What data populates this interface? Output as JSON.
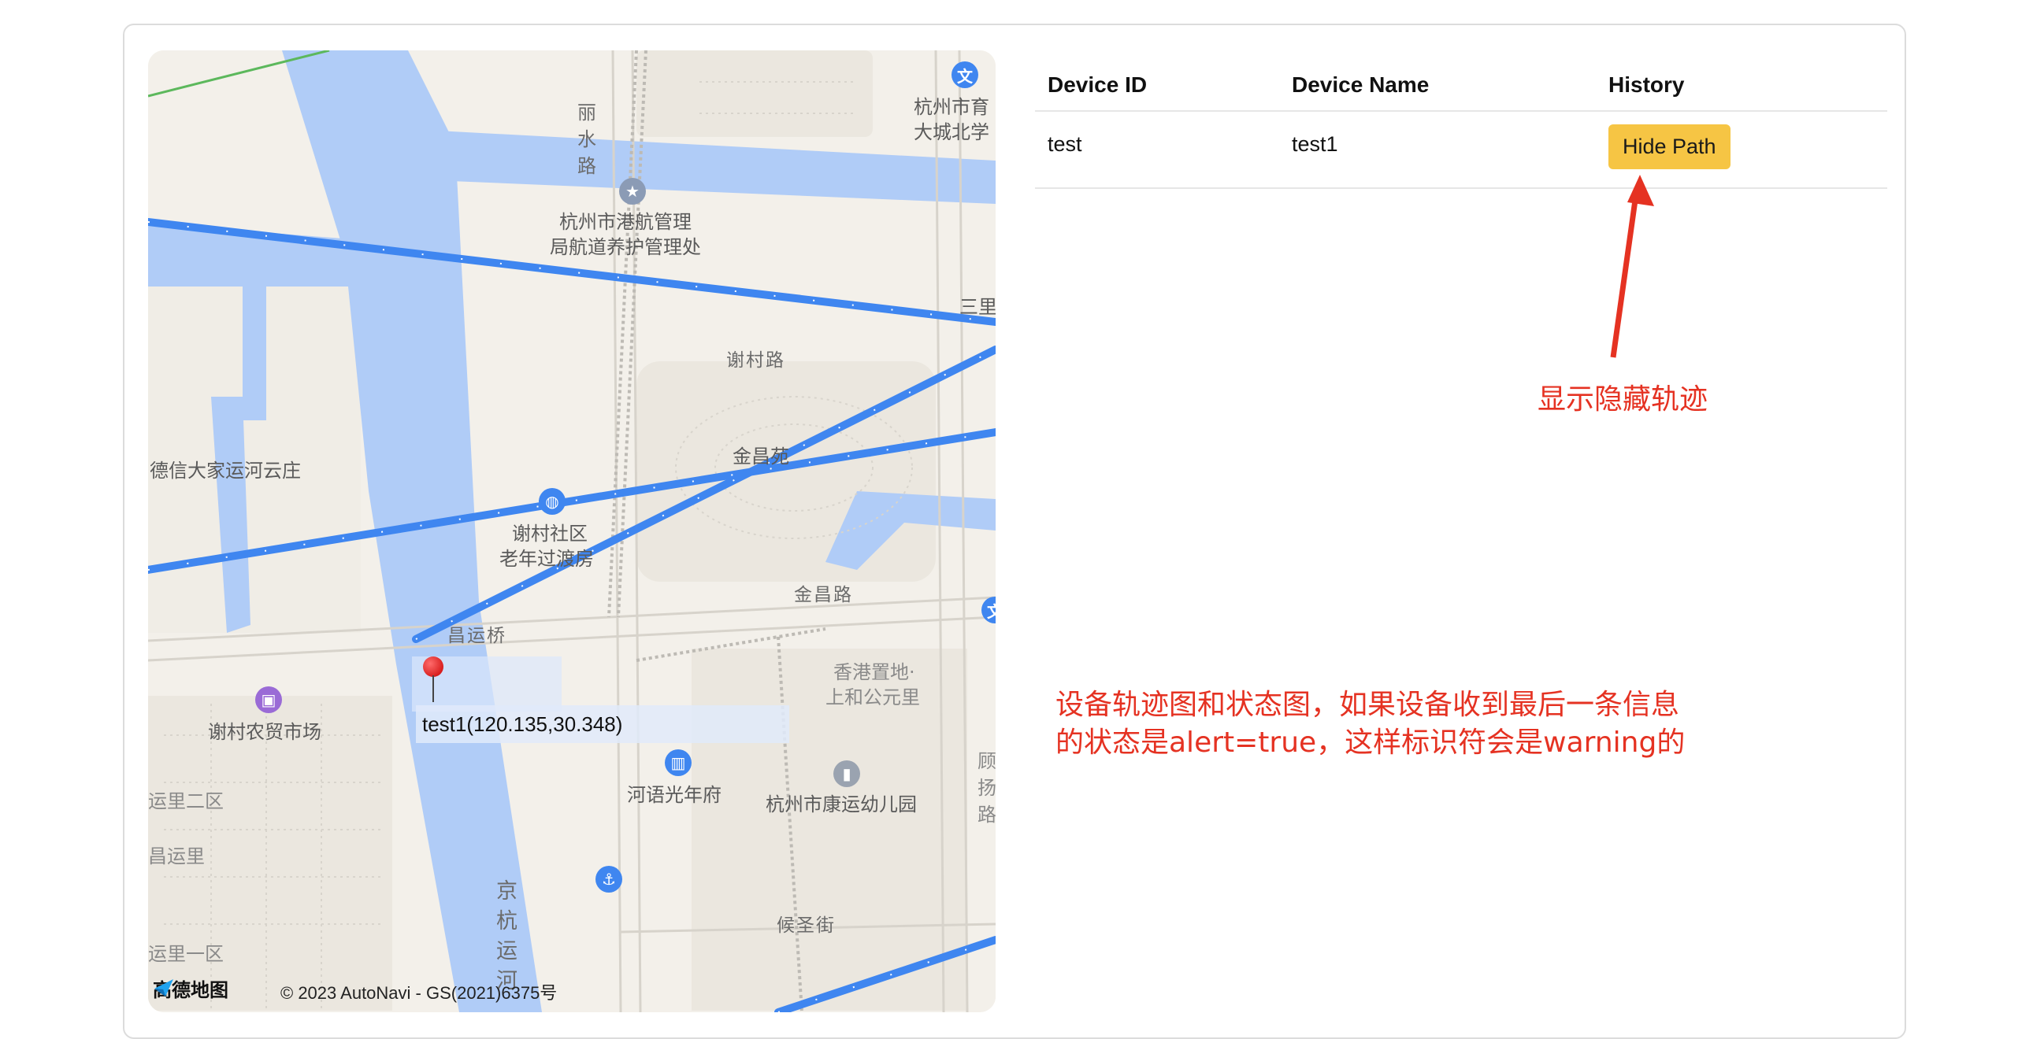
{
  "map": {
    "places": [
      {
        "id": "gangHang",
        "text": "杭州市港航管理"
      },
      {
        "id": "gangHang2",
        "text": "局航道养护管理处"
      },
      {
        "id": "hzEdu",
        "text": "杭州市育"
      },
      {
        "id": "daCheng",
        "text": "大城北学"
      },
      {
        "id": "sanLi",
        "text": "三里"
      },
      {
        "id": "dexin",
        "text": "德信大家运河云庄"
      },
      {
        "id": "jinChang",
        "text": "金昌苑"
      },
      {
        "id": "xieCun",
        "text": "谢村社区"
      },
      {
        "id": "laoNian",
        "text": "老年过渡房"
      },
      {
        "id": "xieCunMarket",
        "text": "谢村农贸市场"
      },
      {
        "id": "hkLand",
        "text": "香港置地·"
      },
      {
        "id": "hkLand2",
        "text": "上和公元里"
      },
      {
        "id": "heYu",
        "text": "河语光年府"
      },
      {
        "id": "kangYun",
        "text": "杭州市康运幼儿园"
      },
      {
        "id": "yunLi2",
        "text": "运里二区"
      },
      {
        "id": "changYunLi",
        "text": "昌运里"
      },
      {
        "id": "yunLi1",
        "text": "运里一区"
      }
    ],
    "roads": [
      {
        "id": "xieCunRoad",
        "text": "谢村路"
      },
      {
        "id": "jinChangRoad",
        "text": "金昌路"
      },
      {
        "id": "changYunBridge",
        "text": "昌运桥"
      },
      {
        "id": "houShengStreet",
        "text": "候圣街"
      }
    ],
    "vertical_roads": [
      {
        "id": "liShui",
        "text": "丽水路"
      },
      {
        "id": "jingHang",
        "text": "京杭运河"
      }
    ],
    "edge_chars": "顾 扬 路",
    "marker_label": "test1(120.135,30.348)",
    "logo_text": "高德地图",
    "copyright": "© 2023 AutoNavi - GS(2021)6375号",
    "colors": {
      "water": "#b0ccf7",
      "path": "#3f86f0",
      "land": "#f3f0ea",
      "green_line": "#5cb85c"
    }
  },
  "table": {
    "headers": {
      "device_id": "Device ID",
      "device_name": "Device Name",
      "history": "History"
    },
    "rows": [
      {
        "device_id": "test",
        "device_name": "test1",
        "button": "Hide Path"
      }
    ]
  },
  "annotations": {
    "arrow_note": "显示隐藏轨迹",
    "description_line1": "设备轨迹图和状态图，如果设备收到最后一条信息",
    "description_line2": "的状态是alert=true，这样标识符会是warning的",
    "color": "#e53222"
  }
}
